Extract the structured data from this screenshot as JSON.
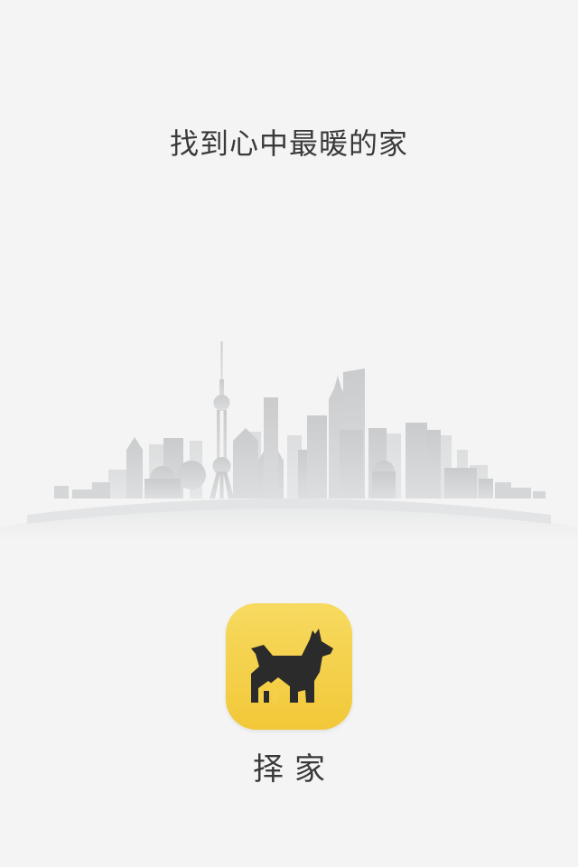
{
  "splash": {
    "tagline": "找到心中最暖的家",
    "app_name": "择家",
    "skyline_icon": "city-skyline-illustration",
    "app_icon": "dog-house-logo-icon",
    "colors": {
      "background": "#f4f4f4",
      "icon_yellow_top": "#f7da60",
      "icon_yellow_bottom": "#f2c838",
      "logo_dark": "#2b2b2b",
      "text": "#3a3a3a",
      "skyline": "#cfd1d2"
    }
  }
}
